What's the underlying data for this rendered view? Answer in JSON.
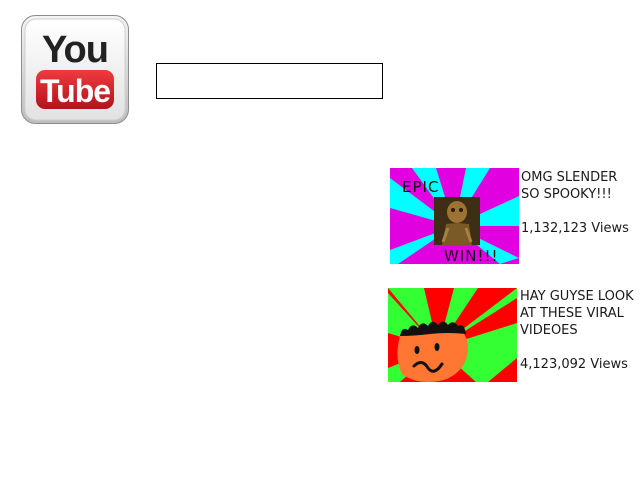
{
  "header": {
    "logo": {
      "word_top": "You",
      "word_bottom": "Tube",
      "icon": "youtube-logo-icon",
      "colors": {
        "frame": "#d0d0d0",
        "text": "#222222",
        "tube_red": "#d8232a"
      }
    },
    "search": {
      "value": "",
      "placeholder": ""
    }
  },
  "videos": [
    {
      "title": "OMG SLENDER SO SPOOKY!!!",
      "views": "1,132,123 Views",
      "thumbnail": {
        "top_text": "EPIC",
        "bottom_text": "WIN!!!",
        "colors": {
          "primary": "#e000e0",
          "secondary": "#00ffff"
        }
      }
    },
    {
      "title": "HAY GUYSE LOOK AT THESE VIRAL VIDEOES",
      "views": "4,123,092 Views",
      "thumbnail": {
        "colors": {
          "primary": "#ff0000",
          "secondary": "#33ff33",
          "face": "#ff7733"
        }
      }
    }
  ]
}
